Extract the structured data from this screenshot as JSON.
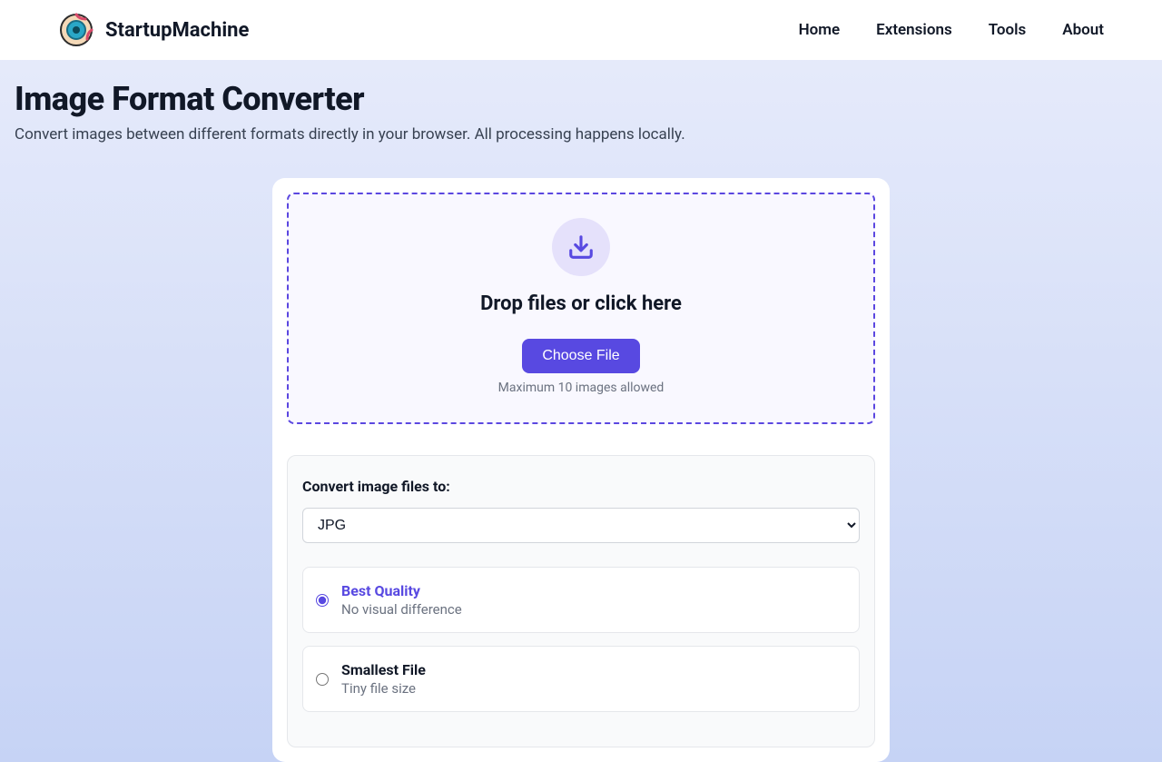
{
  "header": {
    "brand": "StartupMachine",
    "nav": [
      "Home",
      "Extensions",
      "Tools",
      "About"
    ]
  },
  "page": {
    "title": "Image Format Converter",
    "subtitle": "Convert images between different formats directly in your browser. All processing happens locally."
  },
  "dropzone": {
    "title": "Drop files or click here",
    "button": "Choose File",
    "hint": "Maximum 10 images allowed"
  },
  "options": {
    "label": "Convert image files to:",
    "selected_format": "JPG",
    "quality": [
      {
        "title": "Best Quality",
        "desc": "No visual difference",
        "selected": true
      },
      {
        "title": "Smallest File",
        "desc": "Tiny file size",
        "selected": false
      }
    ]
  }
}
